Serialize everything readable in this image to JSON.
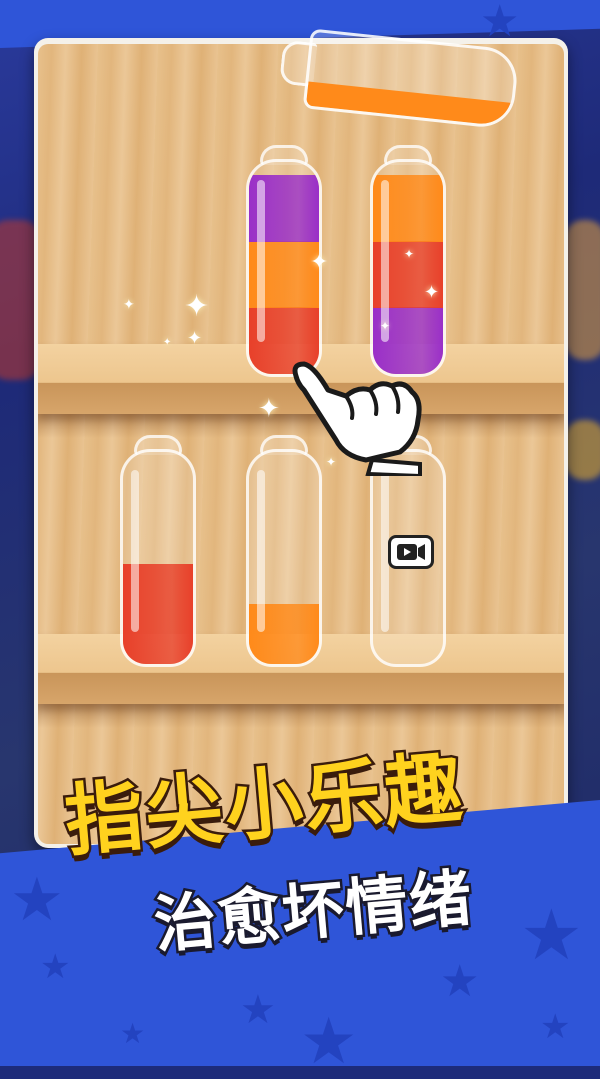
{
  "title": {
    "main": "指尖小乐趣",
    "sub": "治愈坏情绪"
  },
  "colors": {
    "purple": "#9a2fc8",
    "orange": "#ff8a1a",
    "red": "#e8402a",
    "banner_blue": "#2f55d8",
    "title_yellow": "#ffd21e"
  },
  "pouring_bottle": {
    "liquid_color": "orange",
    "fill_fraction": 0.3
  },
  "shelves": [
    {
      "bottles": [
        {
          "layers": [
            "red",
            "orange",
            "purple"
          ],
          "fill_fraction": 1.0
        },
        {
          "layers": [
            "purple",
            "red",
            "orange"
          ],
          "fill_fraction": 1.0
        }
      ]
    },
    {
      "bottles": [
        {
          "layers": [
            "red"
          ],
          "fill_fraction": 0.5
        },
        {
          "layers": [
            "orange"
          ],
          "fill_fraction": 0.3
        },
        {
          "layers": [],
          "fill_fraction": 0.0
        }
      ]
    }
  ],
  "icons": {
    "hand": "pointing-hand-icon",
    "video": "video-ad-icon",
    "sparkle": "sparkle-icon",
    "star": "star-icon"
  }
}
